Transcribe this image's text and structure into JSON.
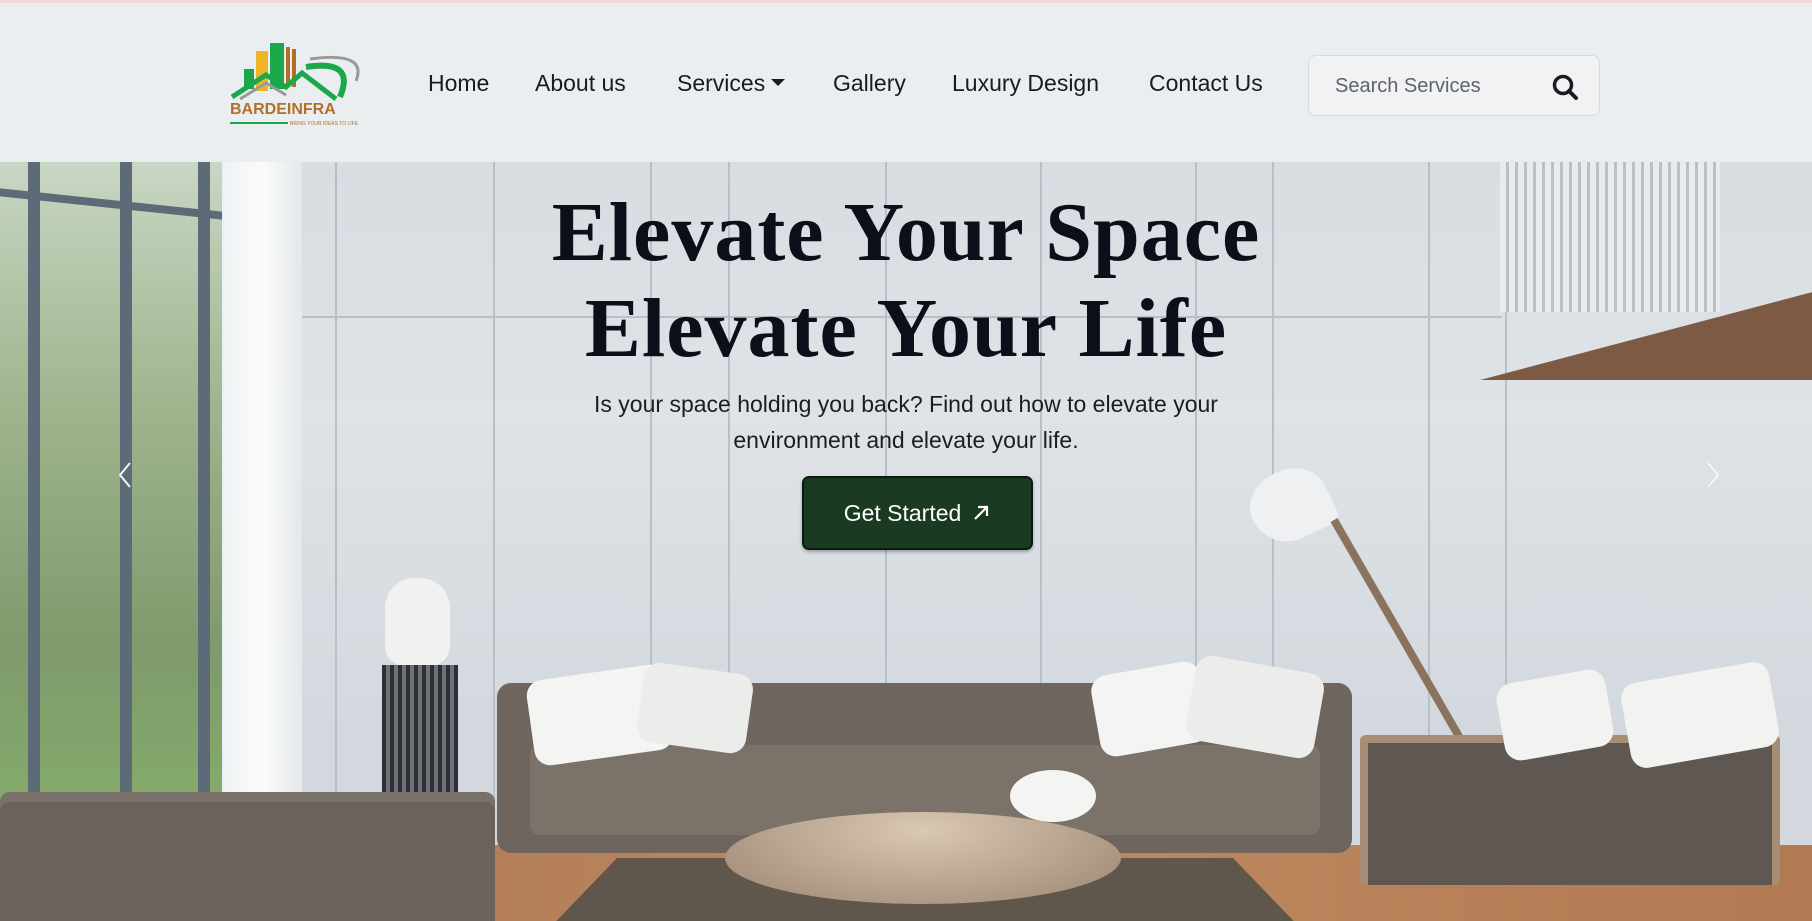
{
  "brand": {
    "name": "BARDEINFRA",
    "tagline": "BRING YOUR IDEAS TO LIFE",
    "colors": {
      "green": "#1aa84a",
      "orange": "#f0b429",
      "brown": "#b0702a"
    }
  },
  "nav": {
    "items": [
      {
        "label": "Home"
      },
      {
        "label": "About us"
      },
      {
        "label": "Services",
        "has_dropdown": true
      },
      {
        "label": "Gallery"
      },
      {
        "label": "Luxury Design"
      },
      {
        "label": "Contact Us"
      }
    ]
  },
  "search": {
    "placeholder": "Search Services",
    "value": "",
    "icon": "search-icon"
  },
  "hero": {
    "title_line1": "Elevate Your Space",
    "title_line2": "Elevate Your Life",
    "subtitle": "Is your space holding you back? Find out how to elevate your environment and elevate your life.",
    "cta_label": "Get Started",
    "cta_icon": "arrow-up-right-icon",
    "cta_color": "#1a3b22"
  },
  "carousel": {
    "prev_icon": "chevron-left-icon",
    "next_icon": "chevron-right-icon"
  }
}
